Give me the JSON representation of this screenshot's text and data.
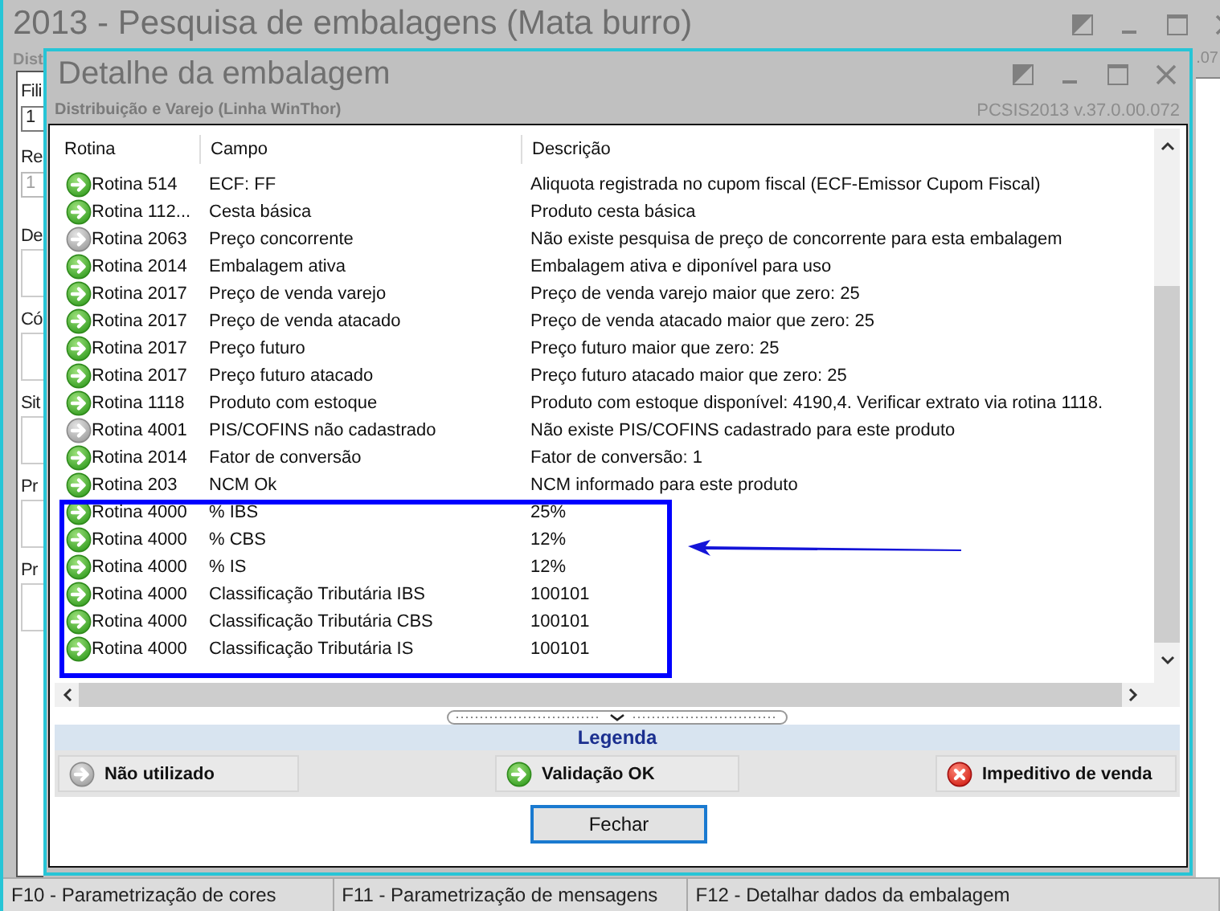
{
  "main_window": {
    "title": "2013 - Pesquisa de embalagens (Mata burro)",
    "subtitle": "Dist",
    "version": ".07",
    "fields": [
      {
        "label": "Fili",
        "value": "1",
        "disabled": false
      },
      {
        "label": "Re",
        "value": "1",
        "disabled": true
      }
    ],
    "groups": [
      "De",
      "Có",
      "Sit",
      "Pr",
      "Pr"
    ]
  },
  "dialog": {
    "title": "Detalhe da embalagem",
    "subtitle": "Distribuição e Varejo (Linha WinThor)",
    "version": "PCSIS2013  v.37.0.00.072",
    "columns": [
      "Rotina",
      "Campo",
      "Descrição"
    ],
    "rows": [
      {
        "kind": "ok",
        "rotina": "Rotina 514",
        "campo": "ECF: FF",
        "descricao": "Aliquota registrada no cupom fiscal (ECF-Emissor Cupom Fiscal)",
        "highlighted": false
      },
      {
        "kind": "ok",
        "rotina": "Rotina 112...",
        "campo": "Cesta básica",
        "descricao": "Produto cesta básica",
        "highlighted": false
      },
      {
        "kind": "unused",
        "rotina": "Rotina 2063",
        "campo": "Preço concorrente",
        "descricao": "Não existe pesquisa de preço de concorrente para esta embalagem",
        "highlighted": false
      },
      {
        "kind": "ok",
        "rotina": "Rotina 2014",
        "campo": "Embalagem ativa",
        "descricao": "Embalagem ativa e diponível para uso",
        "highlighted": false
      },
      {
        "kind": "ok",
        "rotina": "Rotina 2017",
        "campo": "Preço de venda varejo",
        "descricao": "Preço de venda varejo maior que zero: 25",
        "highlighted": false
      },
      {
        "kind": "ok",
        "rotina": "Rotina 2017",
        "campo": "Preço de venda atacado",
        "descricao": "Preço de venda atacado maior que zero: 25",
        "highlighted": false
      },
      {
        "kind": "ok",
        "rotina": "Rotina 2017",
        "campo": "Preço futuro",
        "descricao": "Preço futuro maior que zero: 25",
        "highlighted": false
      },
      {
        "kind": "ok",
        "rotina": "Rotina 2017",
        "campo": "Preço futuro atacado",
        "descricao": "Preço futuro atacado maior que zero: 25",
        "highlighted": false
      },
      {
        "kind": "ok",
        "rotina": "Rotina 1118",
        "campo": "Produto com estoque",
        "descricao": "Produto com estoque disponível: 4190,4. Verificar extrato via rotina 1118.",
        "highlighted": false
      },
      {
        "kind": "unused",
        "rotina": "Rotina 4001",
        "campo": "PIS/COFINS não cadastrado",
        "descricao": "Não existe PIS/COFINS cadastrado para este produto",
        "highlighted": false
      },
      {
        "kind": "ok",
        "rotina": "Rotina 2014",
        "campo": "Fator de conversão",
        "descricao": "Fator de conversão: 1",
        "highlighted": false
      },
      {
        "kind": "ok",
        "rotina": "Rotina 203",
        "campo": "NCM Ok",
        "descricao": "NCM informado para este produto",
        "highlighted": false
      },
      {
        "kind": "ok",
        "rotina": "Rotina 4000",
        "campo": "% IBS",
        "descricao": "25%",
        "highlighted": true
      },
      {
        "kind": "ok",
        "rotina": "Rotina 4000",
        "campo": "% CBS",
        "descricao": "12%",
        "highlighted": true
      },
      {
        "kind": "ok",
        "rotina": "Rotina 4000",
        "campo": "% IS",
        "descricao": "12%",
        "highlighted": true
      },
      {
        "kind": "ok",
        "rotina": "Rotina 4000",
        "campo": "Classificação Tributária IBS",
        "descricao": "100101",
        "highlighted": true
      },
      {
        "kind": "ok",
        "rotina": "Rotina 4000",
        "campo": "Classificação Tributária CBS",
        "descricao": "100101",
        "highlighted": true
      },
      {
        "kind": "ok",
        "rotina": "Rotina 4000",
        "campo": "Classificação Tributária IS",
        "descricao": "100101",
        "highlighted": true
      }
    ],
    "legend": {
      "title": "Legenda",
      "items": [
        {
          "kind": "unused",
          "label": "Não utilizado"
        },
        {
          "kind": "ok",
          "label": "Validação OK"
        },
        {
          "kind": "blocked",
          "label": "Impeditivo de venda"
        }
      ]
    },
    "button": "Fechar"
  },
  "status_bar": [
    "F10 - Parametrização de cores",
    "F11 - Parametrização de mensagens",
    "F12 - Detalhar dados da embalagem"
  ]
}
